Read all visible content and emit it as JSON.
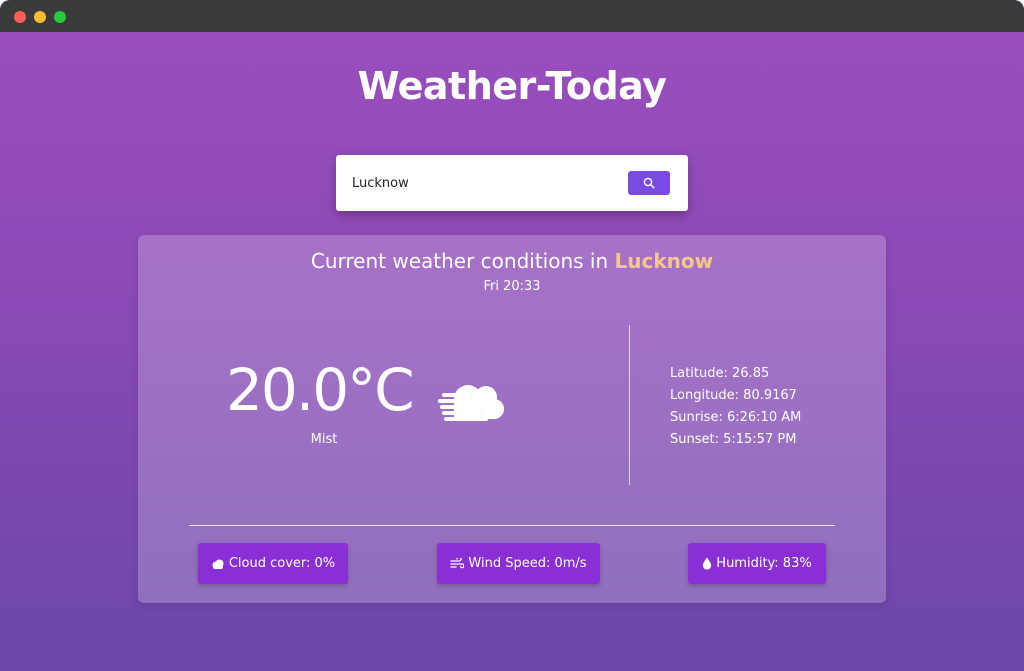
{
  "app": {
    "title": "Weather-Today"
  },
  "search": {
    "value": "Lucknow",
    "button_icon": "search-icon"
  },
  "current": {
    "heading_prefix": "Current weather conditions in",
    "city": "Lucknow",
    "datetime": "Fri 20:33",
    "temperature": "20.0°C",
    "condition": "Mist",
    "condition_icon": "mist-cloud-icon"
  },
  "location": {
    "latitude": "Latitude: 26.85",
    "longitude": "Longitude: 80.9167",
    "sunrise": "Sunrise: 6:26:10 AM",
    "sunset": "Sunset: 5:15:57 PM"
  },
  "stats": {
    "cloud_cover": "Cloud cover: 0%",
    "wind_speed": "Wind Speed: 0m/s",
    "humidity": "Humidity: 83%"
  },
  "colors": {
    "accent": "#7b4ae2",
    "stat_badge": "#8a2fd6",
    "city_highlight": "#f4c88a"
  }
}
